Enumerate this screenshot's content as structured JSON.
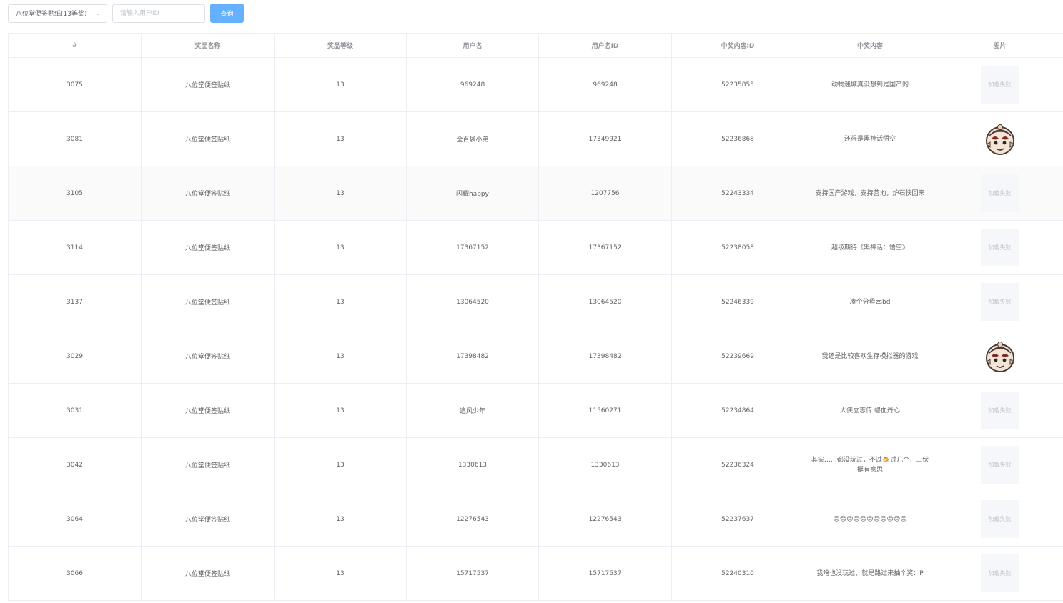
{
  "toolbar": {
    "prize_select": "八位堂便签贴纸(13等奖)",
    "user_id_placeholder": "请输入用户ID",
    "search_label": "查询"
  },
  "table": {
    "headers": [
      "#",
      "奖品名称",
      "奖品等级",
      "用户名",
      "用户名ID",
      "中奖内容ID",
      "中奖内容",
      "图片"
    ],
    "image_failed_text": "加载失败",
    "rows": [
      {
        "id": "3075",
        "prize": "八位堂便签贴纸",
        "level": "13",
        "username": "969248",
        "user_id": "969248",
        "content_id": "52235855",
        "content": "动物迷城真没想到是国产的",
        "image": "failed"
      },
      {
        "id": "3081",
        "prize": "八位堂便签贴纸",
        "level": "13",
        "username": "全百袋小弟",
        "user_id": "17349921",
        "content_id": "52236868",
        "content": "还得是黑神话悟空",
        "image": "sticker"
      },
      {
        "id": "3105",
        "prize": "八位堂便签贴纸",
        "level": "13",
        "username": "闪耀happy",
        "user_id": "1207756",
        "content_id": "52243334",
        "content": "支持国产游戏，支持营地，炉石快回来",
        "image": "failed"
      },
      {
        "id": "3114",
        "prize": "八位堂便签贴纸",
        "level": "13",
        "username": "17367152",
        "user_id": "17367152",
        "content_id": "52238058",
        "content": "超级期待《黑神话：悟空》",
        "image": "failed"
      },
      {
        "id": "3137",
        "prize": "八位堂便签贴纸",
        "level": "13",
        "username": "13064520",
        "user_id": "13064520",
        "content_id": "52246339",
        "content": "凑个分母zsbd",
        "image": "failed"
      },
      {
        "id": "3029",
        "prize": "八位堂便签贴纸",
        "level": "13",
        "username": "17398482",
        "user_id": "17398482",
        "content_id": "52239669",
        "content": "我还是比较喜欢生存模拟器的游戏",
        "image": "sticker"
      },
      {
        "id": "3031",
        "prize": "八位堂便签贴纸",
        "level": "13",
        "username": "追风少年",
        "user_id": "11560271",
        "content_id": "52234864",
        "content": "大侠立志传 碧血丹心",
        "image": "failed"
      },
      {
        "id": "3042",
        "prize": "八位堂便签贴纸",
        "level": "13",
        "username": "1330613",
        "user_id": "1330613",
        "content_id": "52236324",
        "content": "其实……都没玩过，不过🍮过几个，三伏挺有意思",
        "image": "failed"
      },
      {
        "id": "3064",
        "prize": "八位堂便签贴纸",
        "level": "13",
        "username": "12276543",
        "user_id": "12276543",
        "content_id": "52237637",
        "content": "😊😊😊😊😊😊😊😊😊😊😊",
        "image": "failed"
      },
      {
        "id": "3066",
        "prize": "八位堂便签贴纸",
        "level": "13",
        "username": "15717537",
        "user_id": "15717537",
        "content_id": "52240310",
        "content": "我啥也没玩过，就是路过来抽个奖：P",
        "image": "failed"
      }
    ]
  },
  "colors": {
    "primary_button": "#66b1ff",
    "border": "#ebeef5",
    "header_text": "#909399",
    "body_text": "#606266",
    "stripe": "#fafafa"
  }
}
